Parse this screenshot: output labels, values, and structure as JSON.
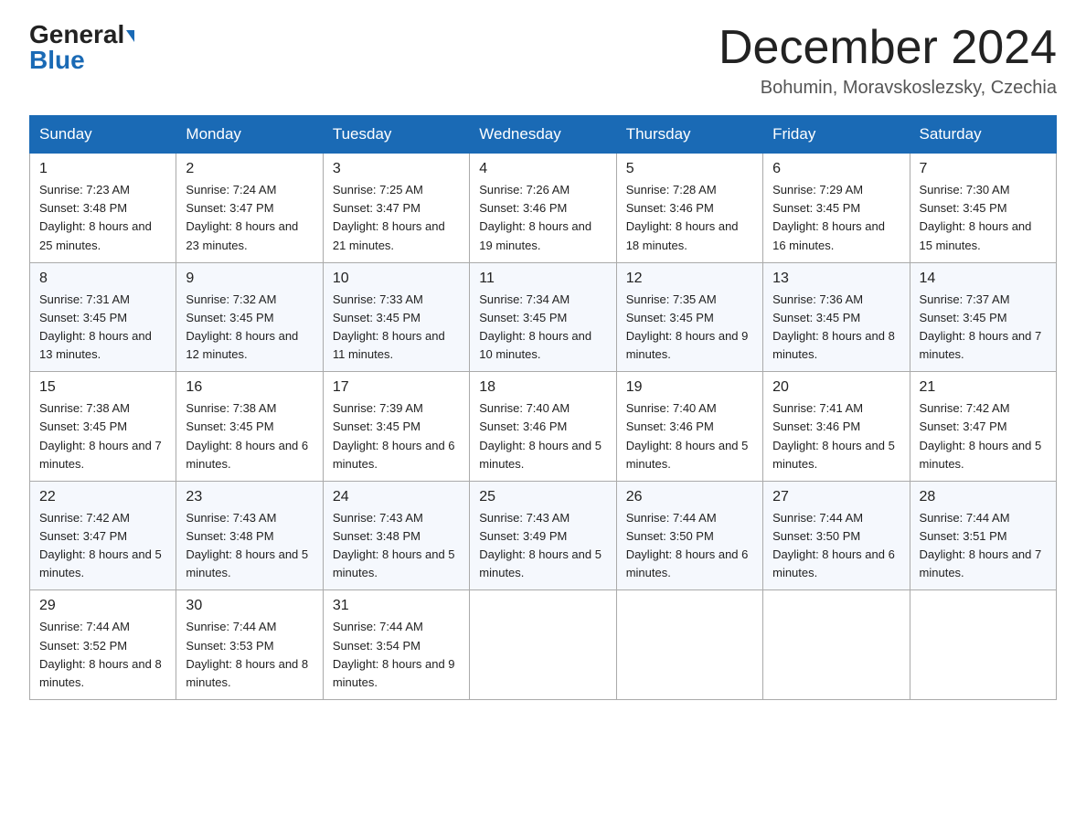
{
  "header": {
    "logo_general": "General",
    "logo_blue": "Blue",
    "month_title": "December 2024",
    "location": "Bohumin, Moravskoslezsky, Czechia"
  },
  "days_of_week": [
    "Sunday",
    "Monday",
    "Tuesday",
    "Wednesday",
    "Thursday",
    "Friday",
    "Saturday"
  ],
  "weeks": [
    [
      {
        "num": "1",
        "sunrise": "7:23 AM",
        "sunset": "3:48 PM",
        "daylight": "8 hours and 25 minutes."
      },
      {
        "num": "2",
        "sunrise": "7:24 AM",
        "sunset": "3:47 PM",
        "daylight": "8 hours and 23 minutes."
      },
      {
        "num": "3",
        "sunrise": "7:25 AM",
        "sunset": "3:47 PM",
        "daylight": "8 hours and 21 minutes."
      },
      {
        "num": "4",
        "sunrise": "7:26 AM",
        "sunset": "3:46 PM",
        "daylight": "8 hours and 19 minutes."
      },
      {
        "num": "5",
        "sunrise": "7:28 AM",
        "sunset": "3:46 PM",
        "daylight": "8 hours and 18 minutes."
      },
      {
        "num": "6",
        "sunrise": "7:29 AM",
        "sunset": "3:45 PM",
        "daylight": "8 hours and 16 minutes."
      },
      {
        "num": "7",
        "sunrise": "7:30 AM",
        "sunset": "3:45 PM",
        "daylight": "8 hours and 15 minutes."
      }
    ],
    [
      {
        "num": "8",
        "sunrise": "7:31 AM",
        "sunset": "3:45 PM",
        "daylight": "8 hours and 13 minutes."
      },
      {
        "num": "9",
        "sunrise": "7:32 AM",
        "sunset": "3:45 PM",
        "daylight": "8 hours and 12 minutes."
      },
      {
        "num": "10",
        "sunrise": "7:33 AM",
        "sunset": "3:45 PM",
        "daylight": "8 hours and 11 minutes."
      },
      {
        "num": "11",
        "sunrise": "7:34 AM",
        "sunset": "3:45 PM",
        "daylight": "8 hours and 10 minutes."
      },
      {
        "num": "12",
        "sunrise": "7:35 AM",
        "sunset": "3:45 PM",
        "daylight": "8 hours and 9 minutes."
      },
      {
        "num": "13",
        "sunrise": "7:36 AM",
        "sunset": "3:45 PM",
        "daylight": "8 hours and 8 minutes."
      },
      {
        "num": "14",
        "sunrise": "7:37 AM",
        "sunset": "3:45 PM",
        "daylight": "8 hours and 7 minutes."
      }
    ],
    [
      {
        "num": "15",
        "sunrise": "7:38 AM",
        "sunset": "3:45 PM",
        "daylight": "8 hours and 7 minutes."
      },
      {
        "num": "16",
        "sunrise": "7:38 AM",
        "sunset": "3:45 PM",
        "daylight": "8 hours and 6 minutes."
      },
      {
        "num": "17",
        "sunrise": "7:39 AM",
        "sunset": "3:45 PM",
        "daylight": "8 hours and 6 minutes."
      },
      {
        "num": "18",
        "sunrise": "7:40 AM",
        "sunset": "3:46 PM",
        "daylight": "8 hours and 5 minutes."
      },
      {
        "num": "19",
        "sunrise": "7:40 AM",
        "sunset": "3:46 PM",
        "daylight": "8 hours and 5 minutes."
      },
      {
        "num": "20",
        "sunrise": "7:41 AM",
        "sunset": "3:46 PM",
        "daylight": "8 hours and 5 minutes."
      },
      {
        "num": "21",
        "sunrise": "7:42 AM",
        "sunset": "3:47 PM",
        "daylight": "8 hours and 5 minutes."
      }
    ],
    [
      {
        "num": "22",
        "sunrise": "7:42 AM",
        "sunset": "3:47 PM",
        "daylight": "8 hours and 5 minutes."
      },
      {
        "num": "23",
        "sunrise": "7:43 AM",
        "sunset": "3:48 PM",
        "daylight": "8 hours and 5 minutes."
      },
      {
        "num": "24",
        "sunrise": "7:43 AM",
        "sunset": "3:48 PM",
        "daylight": "8 hours and 5 minutes."
      },
      {
        "num": "25",
        "sunrise": "7:43 AM",
        "sunset": "3:49 PM",
        "daylight": "8 hours and 5 minutes."
      },
      {
        "num": "26",
        "sunrise": "7:44 AM",
        "sunset": "3:50 PM",
        "daylight": "8 hours and 6 minutes."
      },
      {
        "num": "27",
        "sunrise": "7:44 AM",
        "sunset": "3:50 PM",
        "daylight": "8 hours and 6 minutes."
      },
      {
        "num": "28",
        "sunrise": "7:44 AM",
        "sunset": "3:51 PM",
        "daylight": "8 hours and 7 minutes."
      }
    ],
    [
      {
        "num": "29",
        "sunrise": "7:44 AM",
        "sunset": "3:52 PM",
        "daylight": "8 hours and 8 minutes."
      },
      {
        "num": "30",
        "sunrise": "7:44 AM",
        "sunset": "3:53 PM",
        "daylight": "8 hours and 8 minutes."
      },
      {
        "num": "31",
        "sunrise": "7:44 AM",
        "sunset": "3:54 PM",
        "daylight": "8 hours and 9 minutes."
      },
      null,
      null,
      null,
      null
    ]
  ]
}
